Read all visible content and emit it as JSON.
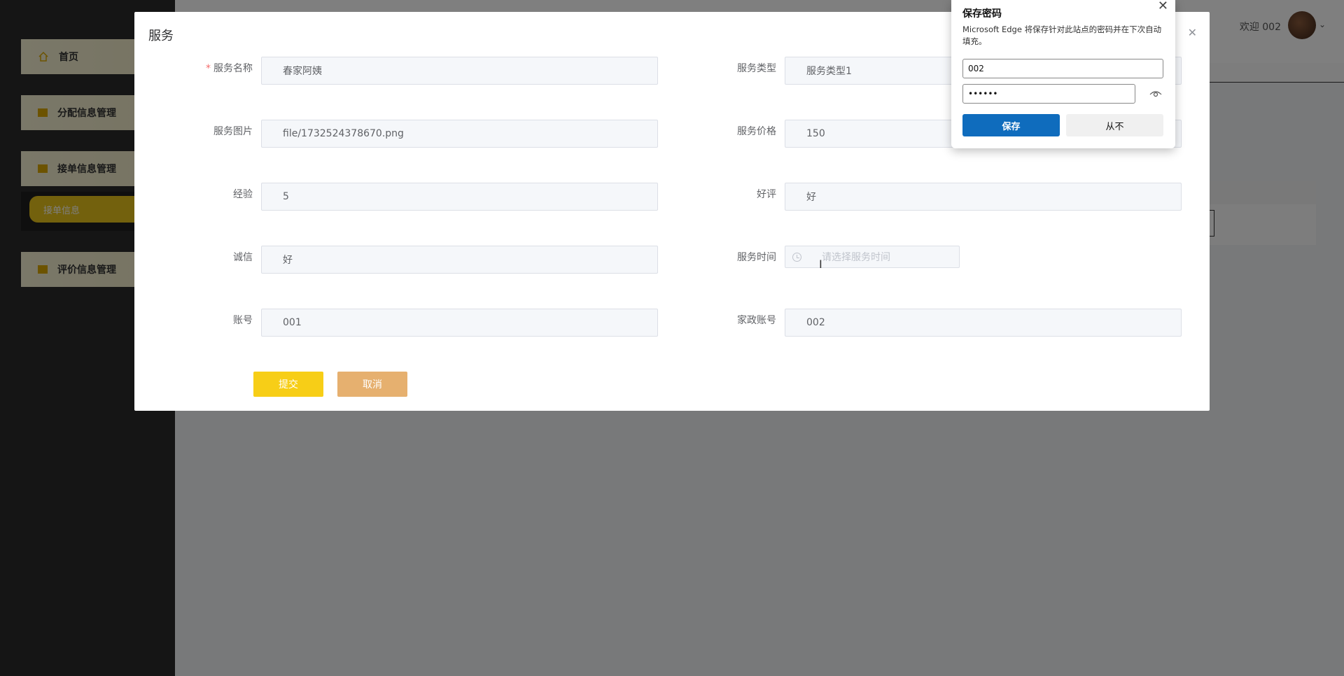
{
  "sidebar": {
    "items": [
      {
        "label": "首页"
      },
      {
        "label": "分配信息管理"
      },
      {
        "label": "接单信息管理"
      },
      {
        "label": "评价信息管理"
      }
    ],
    "sub_item": "接单信息"
  },
  "header": {
    "welcome": "欢迎 002"
  },
  "dialog": {
    "title": "服务",
    "fields": {
      "service_name": {
        "label": "服务名称",
        "value": "春家阿姨",
        "required": true
      },
      "service_type": {
        "label": "服务类型",
        "value": "服务类型1"
      },
      "service_image": {
        "label": "服务图片",
        "value": "file/1732524378670.png"
      },
      "service_price": {
        "label": "服务价格",
        "value": "150"
      },
      "experience": {
        "label": "经验",
        "value": "5"
      },
      "good_review": {
        "label": "好评",
        "value": "好"
      },
      "integrity": {
        "label": "诚信",
        "value": "好"
      },
      "service_time": {
        "label": "服务时间",
        "placeholder": "请选择服务时间"
      },
      "account": {
        "label": "账号",
        "value": "001"
      },
      "housekeeping_account": {
        "label": "家政账号",
        "value": "002"
      }
    },
    "submit_label": "提交",
    "cancel_label": "取消"
  },
  "password_popup": {
    "title": "保存密码",
    "description": "Microsoft Edge 将保存针对此站点的密码并在下次自动填充。",
    "username": "002",
    "password": "••••••",
    "save_label": "保存",
    "never_label": "从不"
  },
  "colors": {
    "accent_yellow": "#f7ce17",
    "cancel_orange": "#e6b06f",
    "edge_blue": "#0f6cbd"
  }
}
